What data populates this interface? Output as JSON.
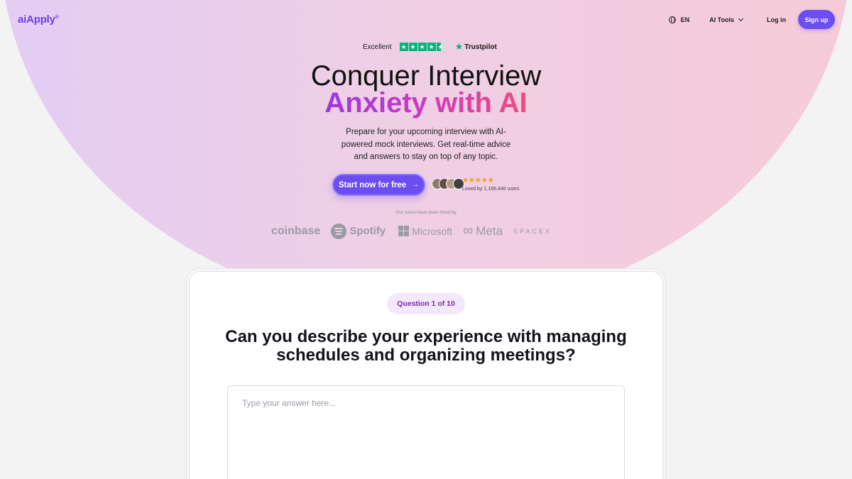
{
  "header": {
    "logo": "aiApply",
    "logo_mark": "®",
    "lang": "EN",
    "tools": "AI Tools",
    "login": "Log in",
    "signup": "Sign up"
  },
  "trustpilot": {
    "rating_word": "Excellent",
    "brand": "Trustpilot",
    "stars": 4.5
  },
  "hero": {
    "title_line1": "Conquer Interview",
    "title_line2": "Anxiety with AI",
    "subtitle": "Prepare for your upcoming interview with AI-powered mock interviews. Get real-time advice and answers to stay on top of any topic.",
    "cta": "Start now for free",
    "cta_arrow": "→",
    "stars": "★★★★★",
    "loved_by": "Loved by 1,166,440 users",
    "hired_by": "Our users have been hired by",
    "companies": [
      "coinbase",
      "Spotify",
      "Microsoft",
      "Meta",
      "SPACEX"
    ]
  },
  "interview": {
    "progress": "Question 1 of 10",
    "question": "Can you describe your experience with managing schedules and organizing meetings?",
    "answer_placeholder": "Type your answer here..."
  },
  "colors": {
    "accent": "#6b4ef0",
    "trustpilot_green": "#00b67a",
    "star_gold": "#f59e0b",
    "pill_bg": "#f3e8fd",
    "pill_text": "#7a2aa8"
  }
}
